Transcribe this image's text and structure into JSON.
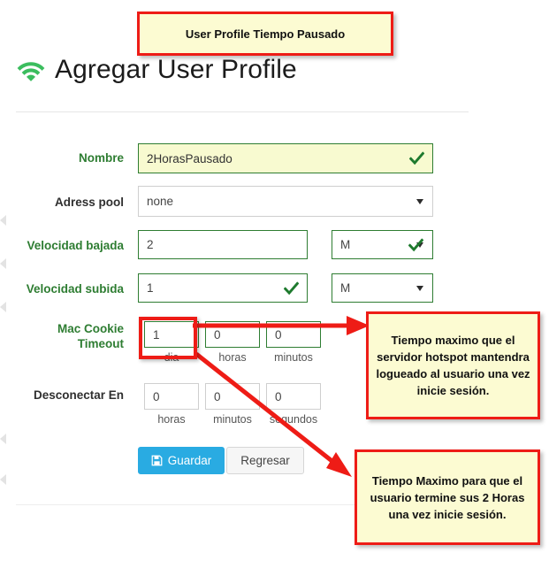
{
  "title_callout": {
    "text": "User Profile Tiempo Pausado"
  },
  "header": {
    "title": "Agregar User Profile",
    "icon": "wifi-icon"
  },
  "form": {
    "fields": [
      {
        "label": "Nombre",
        "label_color": "#2e7d32",
        "type": "text",
        "value": "2HorasPausado",
        "valid": true
      },
      {
        "label": "Adress pool",
        "label_color": "#2f2f2f",
        "type": "select",
        "value": "none"
      },
      {
        "label": "Velocidad bajada",
        "label_color": "#2e7d32",
        "type": "text",
        "value": "2",
        "unit_value": "M",
        "unit_valid": true
      },
      {
        "label": "Velocidad subida",
        "label_color": "#2e7d32",
        "type": "text",
        "value": "1",
        "valid": true,
        "unit_value": "M"
      },
      {
        "label": "Mac Cookie Timeout",
        "label_line1": "Mac Cookie",
        "label_line2": "Timeout",
        "label_color": "#2e7d32",
        "type": "duration",
        "parts": [
          {
            "value": "1",
            "unit": "dia"
          },
          {
            "value": "0",
            "unit": "horas"
          },
          {
            "value": "0",
            "unit": "minutos"
          }
        ]
      },
      {
        "label": "Desconectar En",
        "label_color": "#2f2f2f",
        "type": "duration",
        "parts": [
          {
            "value": "0",
            "unit": "horas"
          },
          {
            "value": "0",
            "unit": "minutos"
          },
          {
            "value": "0",
            "unit": "segundos"
          }
        ]
      }
    ]
  },
  "buttons": {
    "save": "Guardar",
    "save_icon": "floppy-save-icon",
    "back": "Regresar"
  },
  "annotations": [
    {
      "id": "mac-cookie-note",
      "text": "Tiempo maximo que el servidor hotspot mantendra logueado al usuario una vez inicie sesión."
    },
    {
      "id": "disconnect-note",
      "text": "Tiempo Maximo para que el usuario termine sus 2 Horas una vez inicie sesión."
    }
  ],
  "colors": {
    "accent_green": "#2e7d32",
    "annotation_border": "#ee1c16",
    "annotation_bg": "#fcfbd2",
    "primary_button": "#29abe2",
    "wifi_green": "#3bbd5e"
  }
}
